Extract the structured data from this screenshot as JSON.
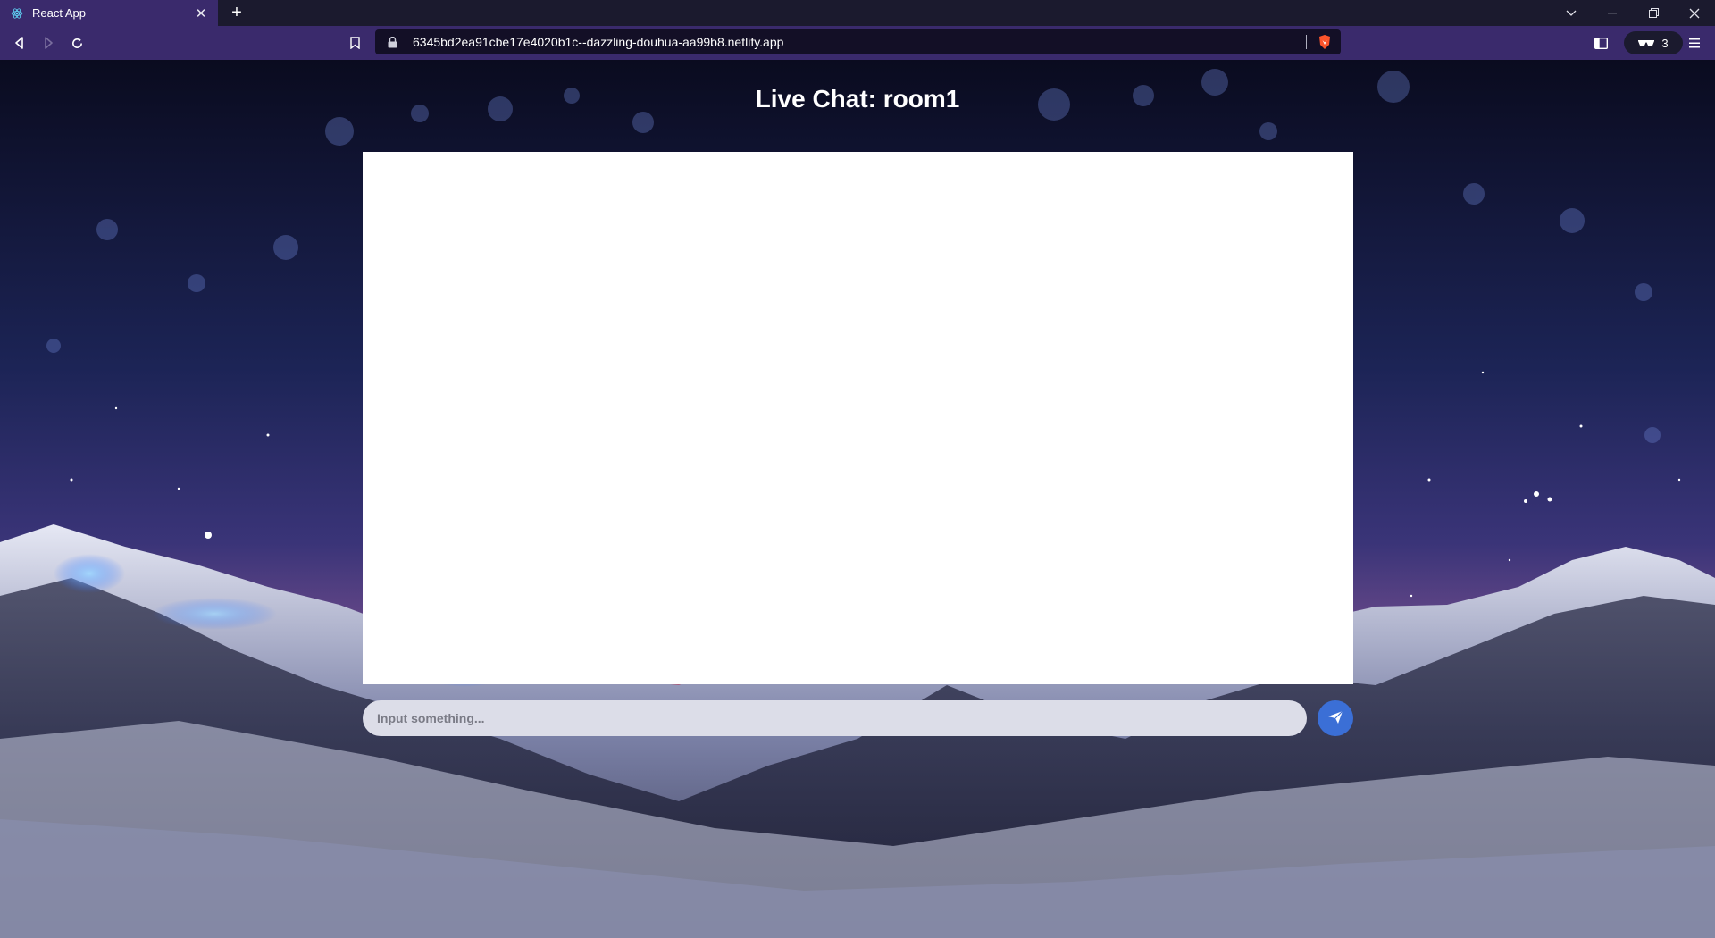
{
  "browser": {
    "tab": {
      "title": "React App"
    },
    "url": "6345bd2ea91cbe17e4020b1c--dazzling-douhua-aa99b8.netlify.app",
    "wallet_count": "3"
  },
  "chat": {
    "title": "Live Chat: room1",
    "input": {
      "placeholder": "Input something...",
      "value": ""
    },
    "send_icon": "paper-plane-icon"
  },
  "colors": {
    "tab_active": "#3a2a6c",
    "tabbar_bg": "#1b1a2e",
    "url_bg": "#130f26",
    "send_button": "#3b6fd6",
    "input_bg": "#dcdde8"
  }
}
